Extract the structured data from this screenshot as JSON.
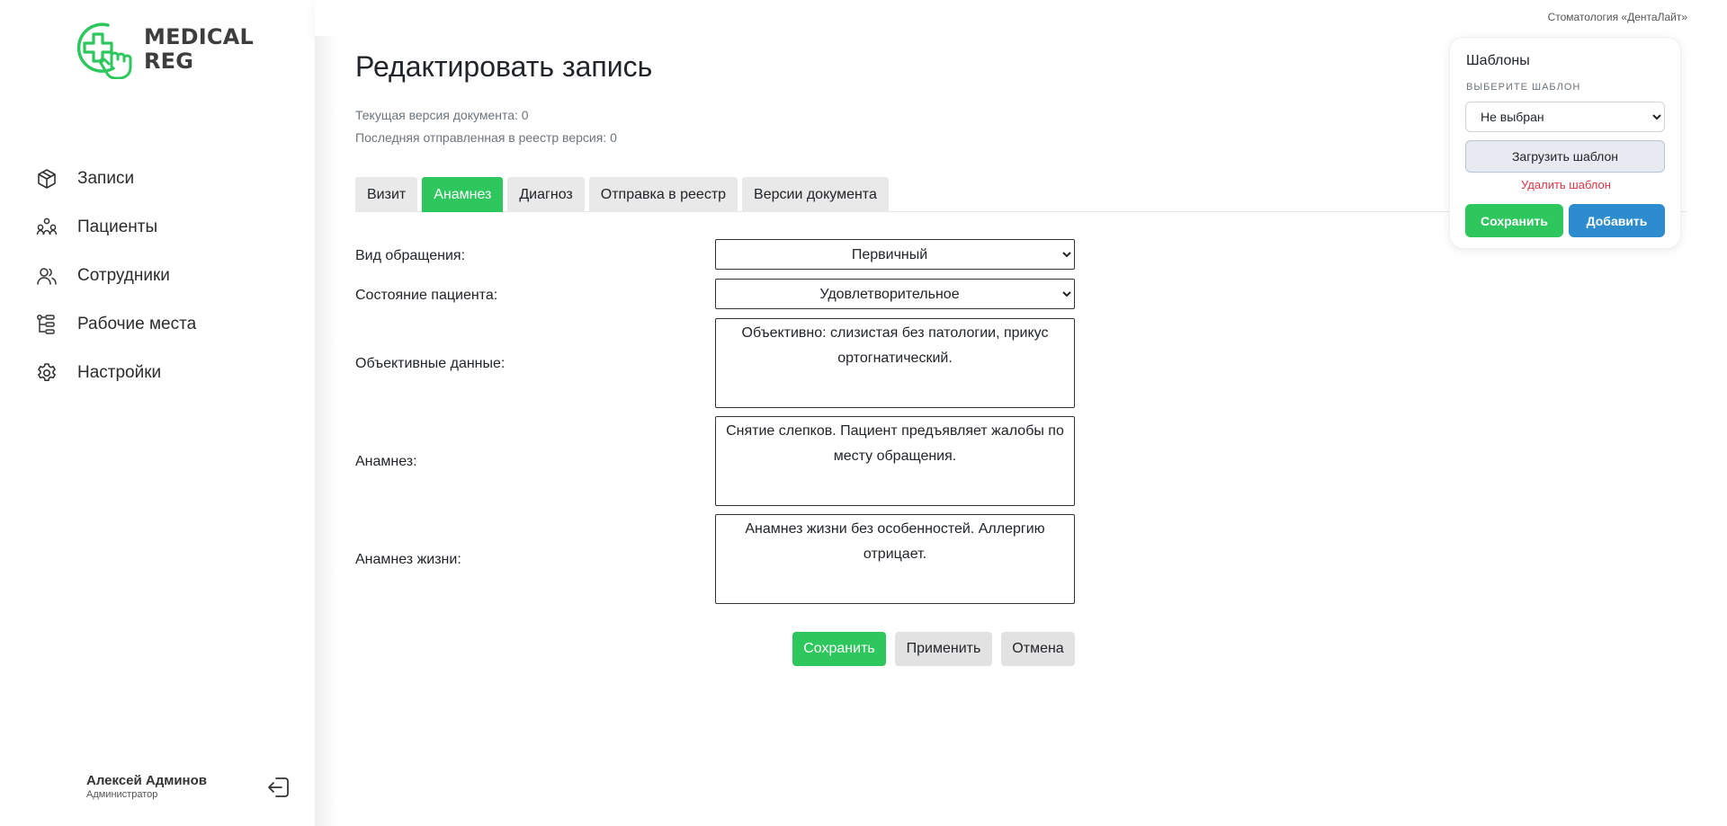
{
  "app": {
    "logo_line1": "MEDICAL",
    "logo_line2": "REG",
    "clinic": "Стоматология «ДентаЛайт»"
  },
  "sidebar": {
    "items": [
      {
        "label": "Записи",
        "icon": "cube-icon"
      },
      {
        "label": "Пациенты",
        "icon": "patients-icon"
      },
      {
        "label": "Сотрудники",
        "icon": "users-icon"
      },
      {
        "label": "Рабочие места",
        "icon": "workplaces-tree-icon"
      },
      {
        "label": "Настройки",
        "icon": "gear-icon"
      }
    ],
    "user": {
      "name": "Алексей Админов",
      "role": "Администратор"
    }
  },
  "page": {
    "title": "Редактировать запись",
    "current_version": "Текущая версия документа: 0",
    "last_sent_version": "Последняя отправленная в реестр версия: 0"
  },
  "tabs": [
    {
      "label": "Визит",
      "active": false
    },
    {
      "label": "Анамнез",
      "active": true
    },
    {
      "label": "Диагноз",
      "active": false
    },
    {
      "label": "Отправка в реестр",
      "active": false
    },
    {
      "label": "Версии документа",
      "active": false
    }
  ],
  "form": {
    "visit_type": {
      "label": "Вид обращения:",
      "value": "Первичный"
    },
    "patient_state": {
      "label": "Состояние пациента:",
      "value": "Удовлетворительное"
    },
    "objective": {
      "label": "Объективные данные:",
      "value": "Объективно: слизистая без патологии, прикус ортогнатический."
    },
    "anamnesis": {
      "label": "Анамнез:",
      "value": "Снятие слепков. Пациент предъявляет жалобы по месту обращения."
    },
    "life_anamnesis": {
      "label": "Анамнез жизни:",
      "value": "Анамнез жизни без особенностей. Аллергию отрицает."
    },
    "buttons": {
      "save": "Сохранить",
      "apply": "Применить",
      "cancel": "Отмена"
    }
  },
  "templates": {
    "title": "Шаблоны",
    "select_label": "Выберите шаблон",
    "selected": "Не выбран",
    "load": "Загрузить шаблон",
    "delete": "Удалить шаблон",
    "save": "Сохранить",
    "add": "Добавить"
  },
  "colors": {
    "accent_green": "#2ec75e",
    "accent_blue": "#2d8cce",
    "danger": "#dc3545"
  }
}
